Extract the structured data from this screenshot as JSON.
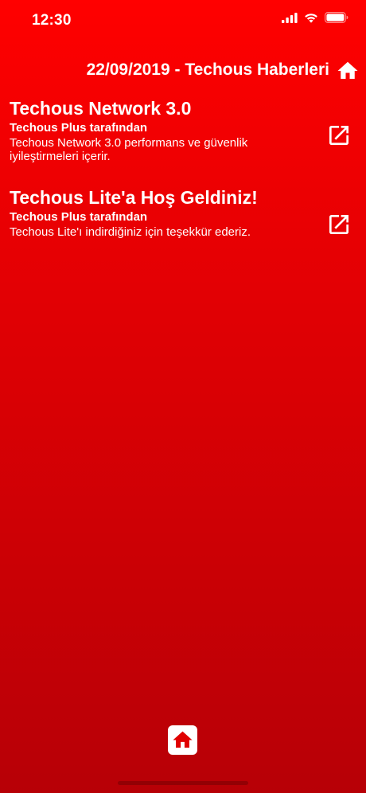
{
  "status_bar": {
    "time": "12:30"
  },
  "header": {
    "title": "22/09/2019 - Techous Haberleri"
  },
  "news": [
    {
      "title": "Techous Network 3.0",
      "author": "Techous Plus tarafından",
      "description": "Techous Network 3.0 performans ve güvenlik iyileştirmeleri içerir."
    },
    {
      "title": "Techous Lite'a Hoş Geldiniz!",
      "author": "Techous Plus tarafından",
      "description": "Techous Lite'ı indirdiğiniz için teşekkür ederiz."
    }
  ],
  "icons": {
    "header_home": "home-icon",
    "news_open": "open-in-new-icon",
    "bottom_home": "home-icon"
  },
  "colors": {
    "gradient_top": "#ff0000",
    "gradient_bottom": "#b70006",
    "foreground": "#ffffff",
    "bottom_home_icon": "#e00000"
  }
}
